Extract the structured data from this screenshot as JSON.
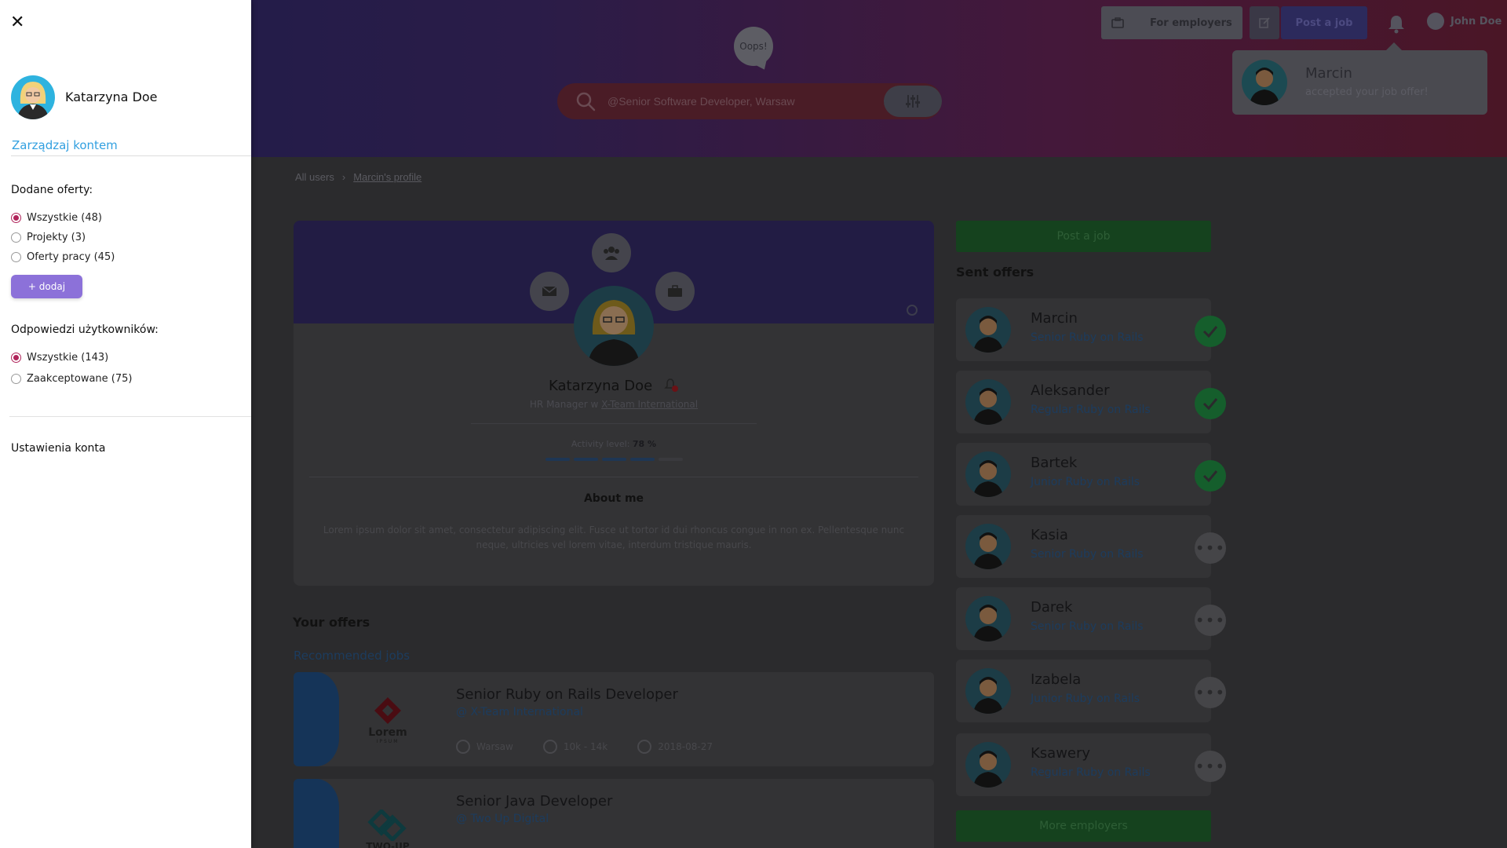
{
  "header": {
    "oops": "Oops!",
    "search_placeholder": "@Senior Software Developer, Warsaw",
    "for_employers": "For employers",
    "post_job": "Post a job",
    "user_name": "John Doe"
  },
  "notification": {
    "name": "Marcin",
    "message": "accepted your job offer!"
  },
  "breadcrumb": {
    "root": "All users",
    "current": "Marcin's profile"
  },
  "profile": {
    "name": "Katarzyna Doe",
    "role_prefix": "HR Manager w ",
    "company": "X-Team International",
    "activity_label": "Activity level: ",
    "activity_value": "78 %",
    "activity_fraction": 0.78,
    "about_title": "About me",
    "about_text": "Lorem ipsum dolor sit amet, consectetur adipiscing elit. Fusce ut tortor id dui rhoncus congue in non ex. Pellentesque nunc neque, ultricies vel lorem vitae, interdum tristique mauris."
  },
  "offers_section": {
    "title": "Your offers",
    "recommended": "Recommended jobs",
    "jobs": [
      {
        "title": "Senior Ruby on Rails Developer",
        "company": "@ X-Team International",
        "city": "Warsaw",
        "salary": "10k - 14k",
        "date": "2018-08-27",
        "logo_text": "Lorem",
        "logo_sub": "IPSUM"
      },
      {
        "title": "Senior Java Developer",
        "company": "@ Two Up Digital",
        "city": "",
        "salary": "",
        "date": "",
        "logo_text": "TWO-UP",
        "logo_sub": ""
      }
    ]
  },
  "sidebar_right": {
    "post_job": "Post a job",
    "sent_title": "Sent offers",
    "more": "More employers",
    "offers": [
      {
        "name": "Marcin",
        "role": "Senior Ruby on Rails",
        "status": "accepted"
      },
      {
        "name": "Aleksander",
        "role": "Regular Ruby on Rails",
        "status": "accepted"
      },
      {
        "name": "Bartek",
        "role": "Junior Ruby on Rails",
        "status": "accepted"
      },
      {
        "name": "Kasia",
        "role": "Senior Ruby on Rails",
        "status": "pending"
      },
      {
        "name": "Darek",
        "role": "Senior Ruby on Rails",
        "status": "pending"
      },
      {
        "name": "Izabela",
        "role": "Junior Ruby on Rails",
        "status": "pending"
      },
      {
        "name": "Ksawery",
        "role": "Regular Ruby on Rails",
        "status": "pending"
      }
    ]
  },
  "drawer": {
    "close": "✕",
    "user_name": "Katarzyna Doe",
    "manage": "Zarządzaj kontem",
    "offers_heading": "Dodane oferty:",
    "offers_filters": [
      {
        "label": "Wszystkie (48)",
        "selected": true
      },
      {
        "label": "Projekty (3)",
        "selected": false
      },
      {
        "label": "Oferty pracy (45)",
        "selected": false
      }
    ],
    "add_button": "+ dodaj",
    "responses_heading": "Odpowiedzi użytkowników:",
    "responses_filters": [
      {
        "label": "Wszystkie (143)",
        "selected": true
      },
      {
        "label": "Zaakceptowane (75)",
        "selected": false
      }
    ],
    "settings": "Ustawienia konta"
  },
  "colors": {
    "accent_blue": "#32a0e0",
    "add_button": "#8c71d9",
    "radio_selected": "#b0245a",
    "green": "#15421e"
  }
}
